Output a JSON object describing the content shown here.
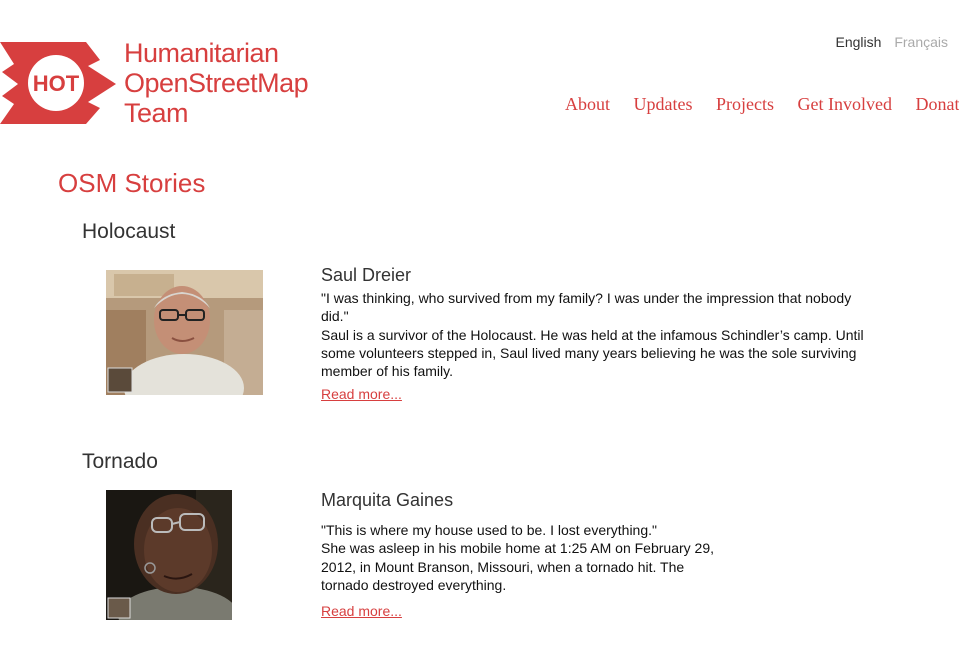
{
  "brand": {
    "logo_badge": "HOT",
    "lines": [
      "Humanitarian",
      "OpenStreetMap",
      "Team"
    ],
    "color": "#d73f3f"
  },
  "languages": [
    {
      "label": "English",
      "active": true
    },
    {
      "label": "Français",
      "active": false
    }
  ],
  "nav": [
    "About",
    "Updates",
    "Projects",
    "Get Involved",
    "Donate"
  ],
  "page": {
    "title": "OSM Stories"
  },
  "stories": [
    {
      "section": "Holocaust",
      "name": "Saul Dreier",
      "quote": "\"I was thinking, who survived from my family? I was under the impression that nobody did.\"",
      "body": "Saul is a survivor of the Holocaust. He was held at the infamous Schindler’s camp. Until some volunteers stepped in, Saul lived many years believing he was the sole surviving member of his family.",
      "read_more": "Read more..."
    },
    {
      "section": "Tornado",
      "name": "Marquita Gaines",
      "quote": "\"This is where my house used to be. I lost everything.\"",
      "body": "She was asleep in his mobile home at 1:25 AM on February 29, 2012, in Mount Branson, Missouri, when a tornado hit. The tornado destroyed everything.",
      "read_more": "Read more..."
    }
  ]
}
